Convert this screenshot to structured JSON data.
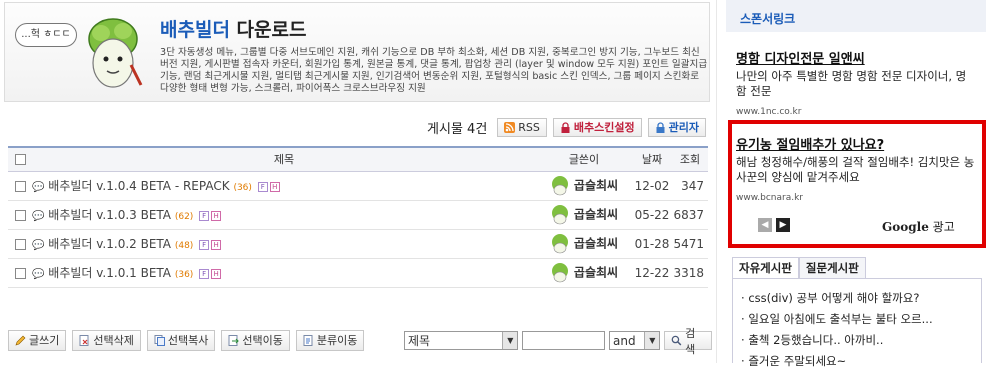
{
  "header": {
    "bubble": "...헉 ㅎㄷㄷ",
    "title_accent": "배추빌더",
    "title_rest": " 다운로드",
    "description": "3단 자동생성 메뉴, 그룹별 다중 서브도메인 지원, 캐쉬 기능으로 DB 부하 최소화, 세션 DB 지원, 중복로그인 방지 기능, 그누보드 최신버전 지원, 게시판별 접속자 카운터, 회원가입 통계, 원본글 통계, 댓글 통계, 팝업창 관리 (layer 및 window 모두 지원) 포인트 일괄지급 기능, 랜덤 최근게시물 지원, 멀티탭 최근게시물 지원, 인기검색어 변동순위 지원, 포털형식의 basic 스킨 인덱스, 그룹 페이지 스킨화로 다양한 형태 변형 가능, 스크롤러, 파이어폭스 크로스브라우징 지원"
  },
  "toolbar": {
    "post_count": "게시물 4건",
    "rss_label": "RSS",
    "skin_settings_label": "배추스킨설정",
    "admin_label": "관리자"
  },
  "table": {
    "headers": {
      "subject": "제목",
      "writer": "글쓴이",
      "date": "날짜",
      "views": "조회"
    },
    "rows": [
      {
        "subject": "배추빌더 v.1.0.4 BETA - REPACK",
        "comments": "(36)",
        "writer": "곱슬최씨",
        "date": "12-02",
        "views": "347"
      },
      {
        "subject": "배추빌더 v.1.0.3 BETA",
        "comments": "(62)",
        "writer": "곱슬최씨",
        "date": "05-22",
        "views": "6837"
      },
      {
        "subject": "배추빌더 v.1.0.2 BETA",
        "comments": "(48)",
        "writer": "곱슬최씨",
        "date": "01-28",
        "views": "5471"
      },
      {
        "subject": "배추빌더 v.1.0.1 BETA",
        "comments": "(36)",
        "writer": "곱슬최씨",
        "date": "12-22",
        "views": "3318"
      }
    ],
    "tag_f": "F",
    "tag_h": "H"
  },
  "bottom": {
    "write": "글쓰기",
    "delete_selected": "선택삭제",
    "copy_selected": "선택복사",
    "move_selected": "선택이동",
    "move_category": "분류이동"
  },
  "search": {
    "field_value": "제목",
    "operator_value": "and",
    "button_label": "검색"
  },
  "sidebar": {
    "sponsor_title": "스폰서링크",
    "ads": [
      {
        "headline": "명함 디자인전문 일앤씨",
        "body": "나만의 아주 특별한 명함 명함 전문 디자이너, 명함 전문",
        "url": "www.1nc.co.kr"
      },
      {
        "headline": "유기농 절임배추가 있나요?",
        "body": "해남 청정해수/해풍의 걸작 절임배추! 김치맛은 농사꾼의 양심에 맡겨주세요",
        "url": "www.bcnara.kr"
      }
    ],
    "google_word": "Google",
    "ad_word": " 광고",
    "tabs": [
      "자유게시판",
      "질문게시판"
    ],
    "posts": [
      "css(div) 공부 어떻게 해야 할까요?",
      "일요일 아침에도 출석부는 불타 오르...",
      "출첵 2등했습니다.. 아까비..",
      "즐거운 주말되세요~"
    ]
  },
  "colors": {
    "accent": "#1b5cb8",
    "highlight_border": "#e00000",
    "comment_count": "#e07b00"
  }
}
